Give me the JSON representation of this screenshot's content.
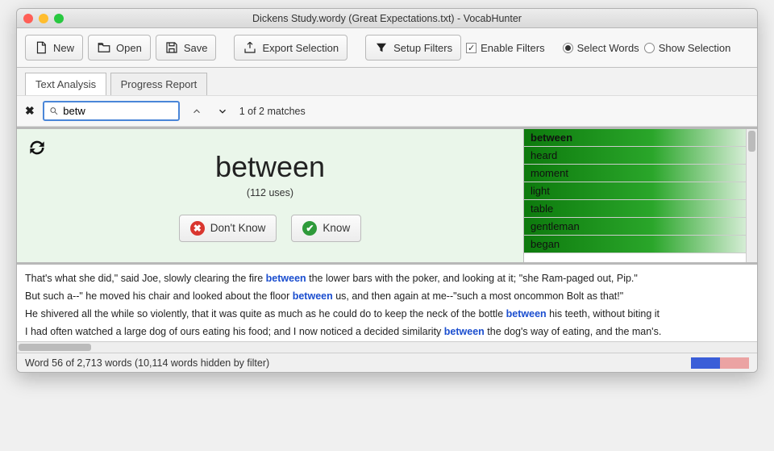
{
  "window": {
    "title": "Dickens Study.wordy (Great Expectations.txt) - VocabHunter"
  },
  "toolbar": {
    "new": "New",
    "open": "Open",
    "save": "Save",
    "export": "Export Selection",
    "setup_filters": "Setup Filters",
    "enable_filters": "Enable Filters",
    "select_words": "Select Words",
    "show_selection": "Show Selection"
  },
  "tabs": {
    "analysis": "Text Analysis",
    "progress": "Progress Report"
  },
  "search": {
    "value": "betw",
    "matches": "1 of 2 matches"
  },
  "word": {
    "current": "between",
    "uses": "(112 uses)",
    "dont_know": "Don't Know",
    "know": "Know"
  },
  "wordlist": [
    "between",
    "heard",
    "moment",
    "light",
    "table",
    "gentleman",
    "began"
  ],
  "examples": [
    {
      "pre": "That's what she did,\" said Joe, slowly clearing the fire ",
      "kw": "between",
      "post": " the lower bars with the poker, and looking at it; \"she Ram-paged out, Pip.\""
    },
    {
      "pre": "But such a--\" he moved his chair and looked about the floor ",
      "kw": "between",
      "post": " us, and then again at me--\"such a most oncommon Bolt as that!\""
    },
    {
      "pre": "He shivered all the while so violently, that it was quite as much as he could do to keep the neck of the bottle ",
      "kw": "between",
      "post": " his teeth, without biting it"
    },
    {
      "pre": "I had often watched a large dog of ours eating his food; and I now noticed a decided similarity ",
      "kw": "between",
      "post": " the dog's way of eating, and the man's."
    }
  ],
  "status": {
    "text": "Word 56 of 2,713 words (10,114 words hidden by filter)"
  }
}
